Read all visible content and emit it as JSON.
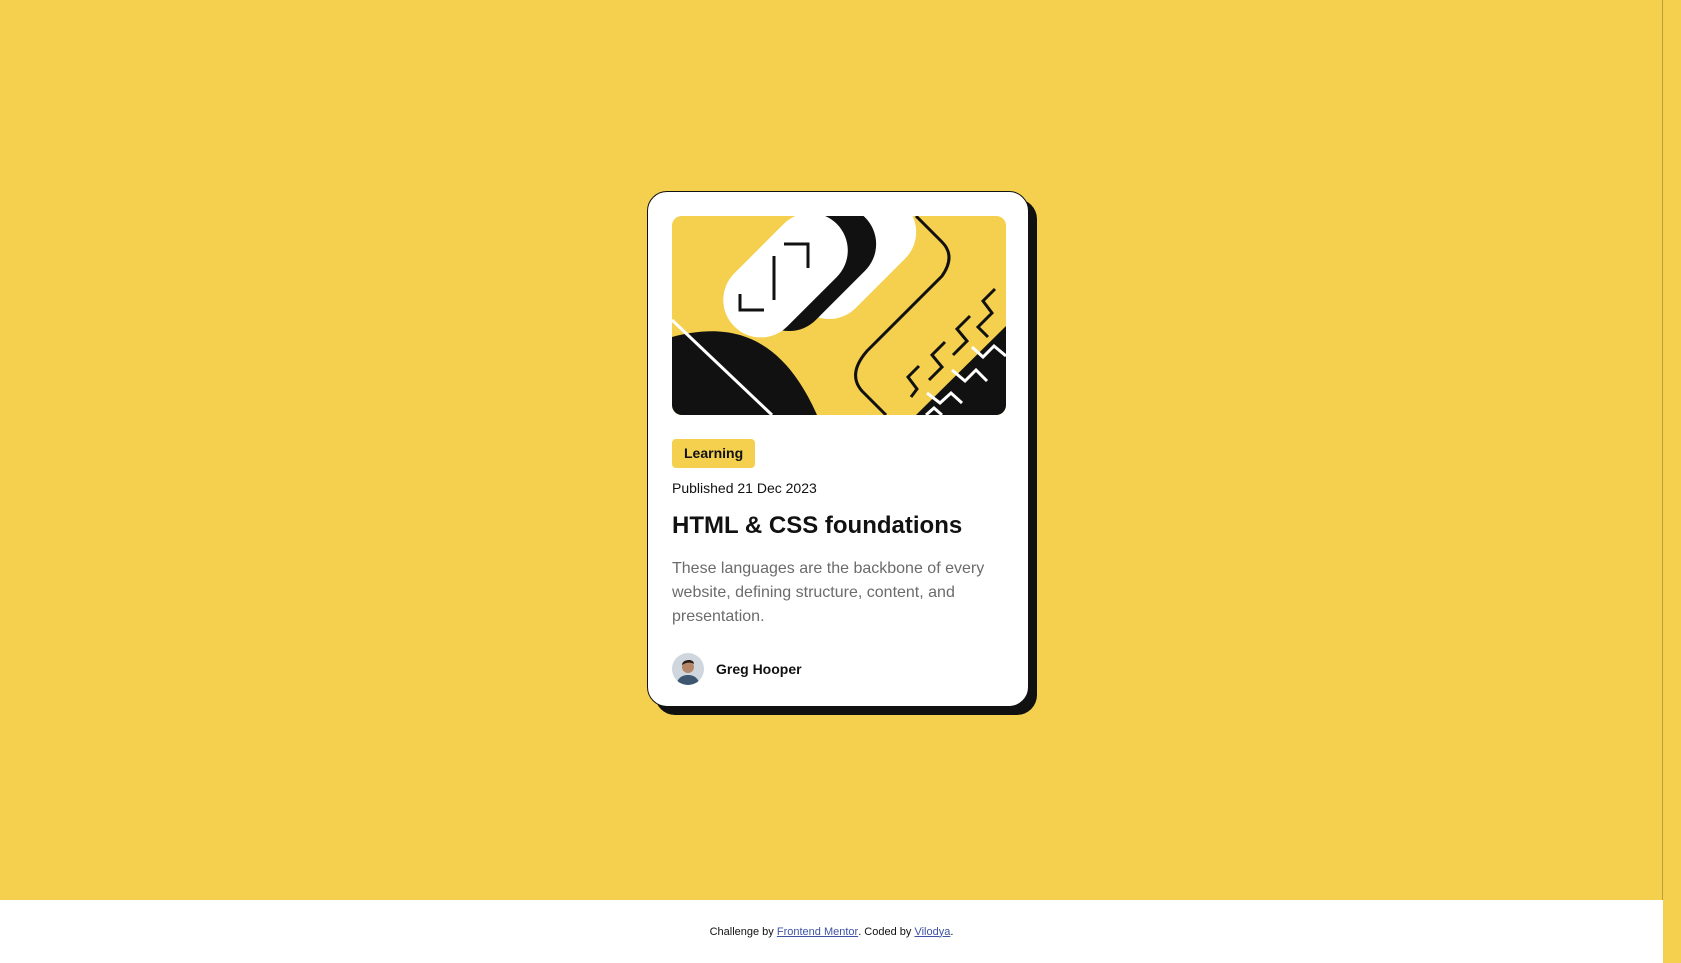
{
  "card": {
    "image_alt": "illustration-article",
    "category": "Learning",
    "published": "Published 21 Dec 2023",
    "title": "HTML & CSS foundations",
    "description": "These languages are the backbone of every website, defining structure, content, and presentation.",
    "author": "Greg Hooper"
  },
  "footer": {
    "prefix": "Challenge by ",
    "link1": "Frontend Mentor",
    "middle": ". Coded by ",
    "link2": "Vilodya",
    "suffix": "."
  },
  "colors": {
    "background": "#f4d04e",
    "ink": "#111111",
    "muted_text": "#6b6b6b",
    "card": "#ffffff",
    "link": "#3e52a3"
  }
}
